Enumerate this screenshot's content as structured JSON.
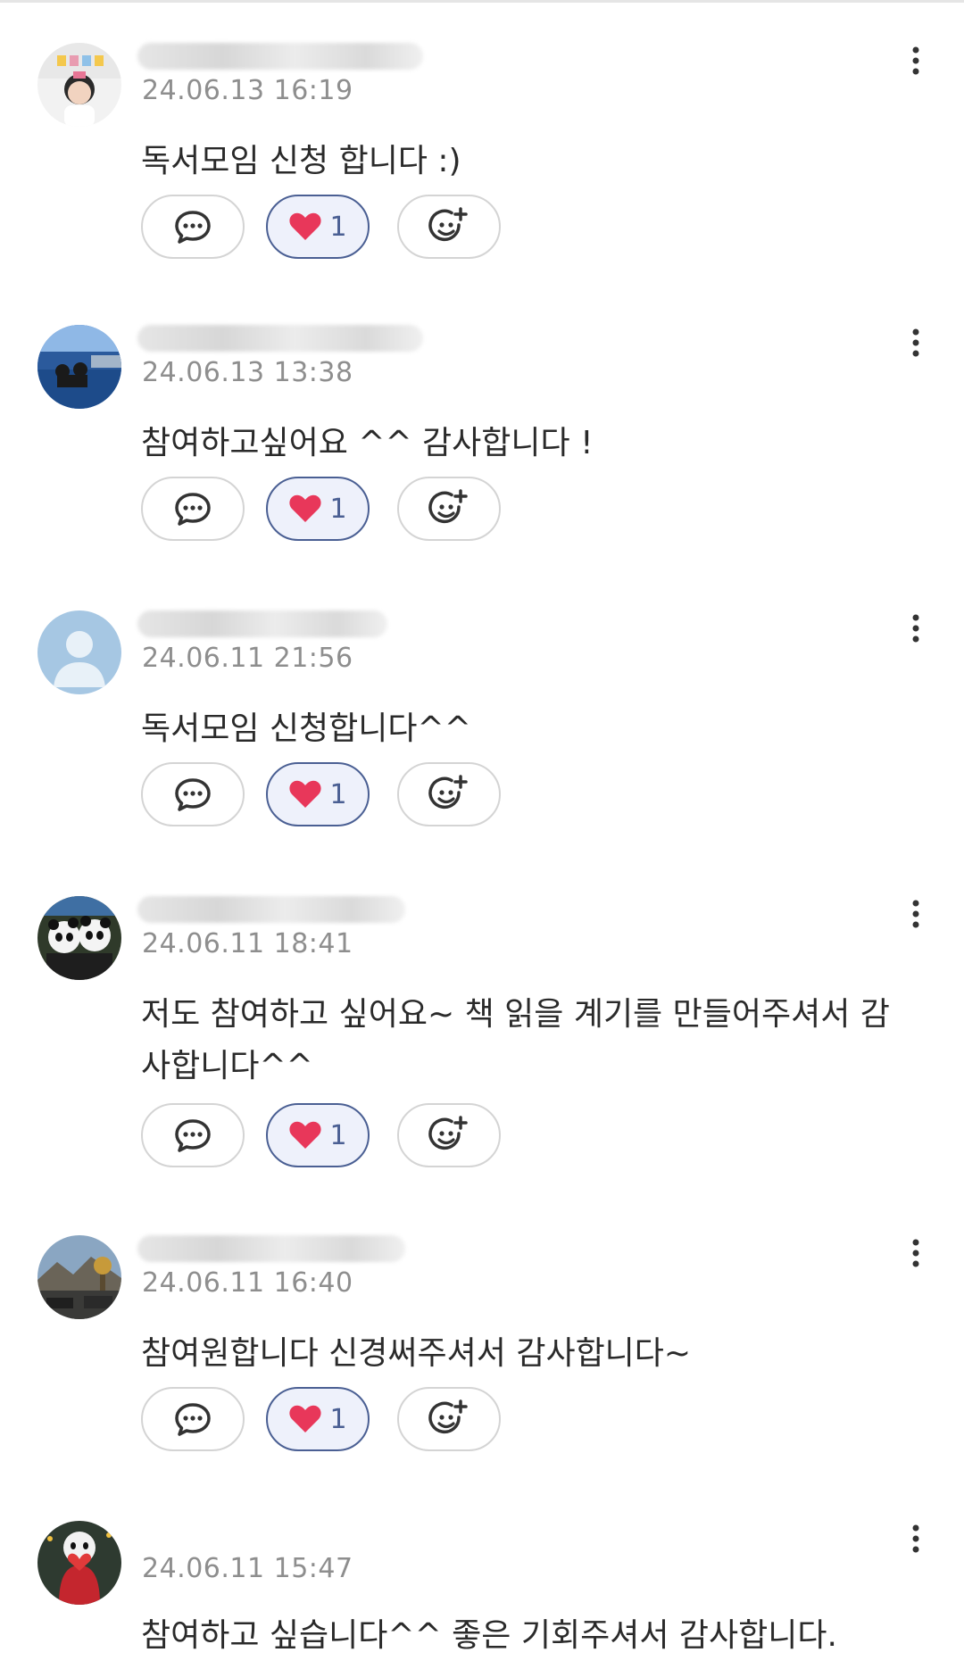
{
  "comments": [
    {
      "date": "24.06.13 16:19",
      "text": "독서모임 신청 합니다 :)",
      "like_count": "1",
      "avatar_icon": "profile-photo-girl-icon"
    },
    {
      "date": "24.06.13 13:38",
      "text": "참여하고싶어요 ^^ 감사합니다 !",
      "like_count": "1",
      "avatar_icon": "profile-photo-pool-icon"
    },
    {
      "date": "24.06.11 21:56",
      "text": "독서모임 신청합니다^^",
      "like_count": "1",
      "avatar_icon": "default-avatar-icon"
    },
    {
      "date": "24.06.11 18:41",
      "text": "저도 참여하고 싶어요~ 책 읽을 계기를 만들어주셔서 감사합니다^^",
      "like_count": "1",
      "avatar_icon": "profile-photo-pandas-icon"
    },
    {
      "date": "24.06.11 16:40",
      "text": "참여원합니다 신경써주셔서 감사합니다~",
      "like_count": "1",
      "avatar_icon": "profile-photo-landscape-icon"
    },
    {
      "date": "24.06.11 15:47",
      "text": "참여하고 싶습니다^^ 좋은 기회주셔서 감사합니다.",
      "like_count": "",
      "avatar_icon": "profile-photo-love-doll-icon"
    }
  ],
  "colors": {
    "accent": "#4a5f93",
    "heart": "#e8375a",
    "date": "#8e8e8e",
    "text": "#2a2a2a"
  }
}
